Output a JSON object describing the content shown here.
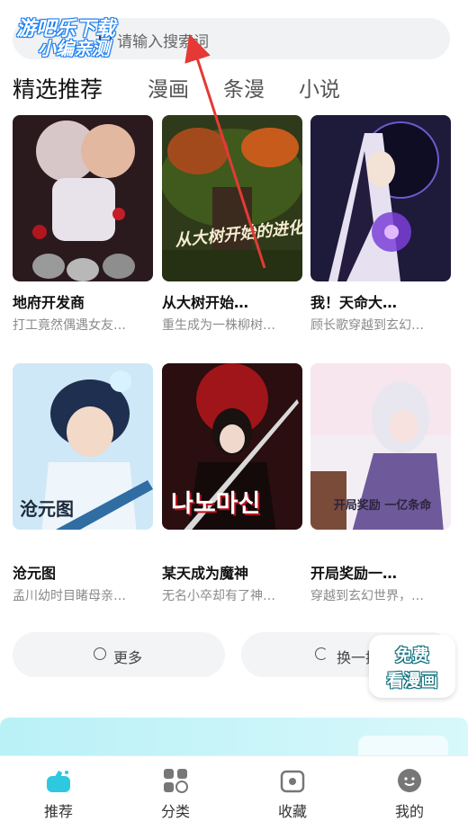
{
  "search": {
    "placeholder": "请输入搜索词"
  },
  "watermark": {
    "line1": "游吧乐下载",
    "line2": "小编亲测"
  },
  "tabs": [
    {
      "label": "精选推荐",
      "active": true
    },
    {
      "label": "漫画",
      "active": false
    },
    {
      "label": "条漫",
      "active": false
    },
    {
      "label": "小说",
      "active": false
    }
  ],
  "comics": [
    {
      "title": "地府开发商",
      "desc": "打工竟然偶遇女友…",
      "cover_text": ""
    },
    {
      "title": "从大树开始…",
      "desc": "重生成为一株柳树…",
      "cover_text": "从大树开始的进化"
    },
    {
      "title": "我！天命大…",
      "desc": "顾长歌穿越到玄幻…",
      "cover_text": ""
    },
    {
      "title": "沧元图",
      "desc": "孟川幼时目睹母亲…",
      "cover_text": "沧元图"
    },
    {
      "title": "某天成为魔神",
      "desc": "无名小卒却有了神…",
      "cover_text": "나노마신"
    },
    {
      "title": "开局奖励一…",
      "desc": "穿越到玄幻世界，…",
      "cover_text": "开局奖励 一亿条命"
    }
  ],
  "actions": {
    "more": "更多",
    "refresh": "换一换"
  },
  "free_badge": {
    "line1": "免费",
    "line2": "看漫画"
  },
  "bottom_nav": [
    {
      "label": "推荐",
      "icon": "recommend-icon",
      "active": true
    },
    {
      "label": "分类",
      "icon": "category-icon",
      "active": false
    },
    {
      "label": "收藏",
      "icon": "favorites-icon",
      "active": false
    },
    {
      "label": "我的",
      "icon": "profile-icon",
      "active": false
    }
  ],
  "colors": {
    "accent": "#2ec9e0",
    "arrow": "#e53935"
  }
}
